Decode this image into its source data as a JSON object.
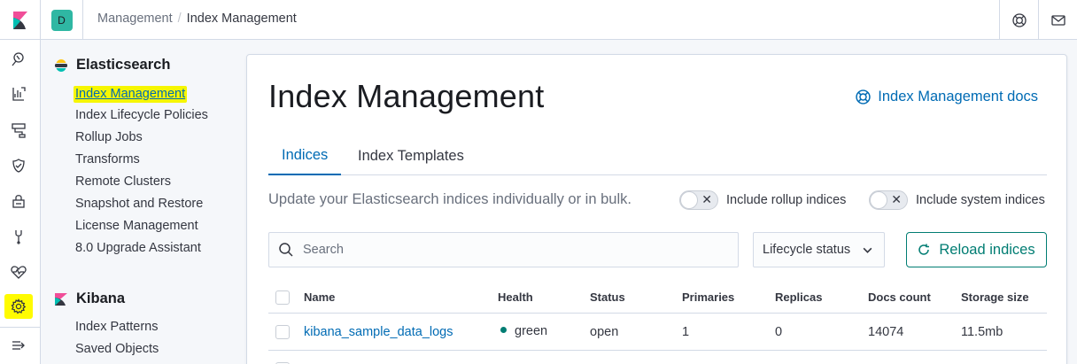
{
  "header": {
    "space_initial": "D",
    "breadcrumb_parent": "Management",
    "breadcrumb_separator": "/",
    "breadcrumb_current": "Index Management"
  },
  "left_nav_icons": [
    "discover-icon",
    "visualize-icon",
    "canvas-icon",
    "siem-icon",
    "security-icon",
    "dev-tools-icon",
    "monitoring-icon",
    "management-gear-icon",
    "collapse-menu-icon"
  ],
  "sidenav": {
    "elasticsearch_title": "Elasticsearch",
    "elasticsearch_items": [
      "Index Management",
      "Index Lifecycle Policies",
      "Rollup Jobs",
      "Transforms",
      "Remote Clusters",
      "Snapshot and Restore",
      "License Management",
      "8.0 Upgrade Assistant"
    ],
    "kibana_title": "Kibana",
    "kibana_items": [
      "Index Patterns",
      "Saved Objects"
    ]
  },
  "main": {
    "title": "Index Management",
    "docs_link": "Index Management docs",
    "tabs": [
      "Indices",
      "Index Templates"
    ],
    "description": "Update your Elasticsearch indices individually or in bulk.",
    "toggle_rollup": "Include rollup indices",
    "toggle_system": "Include system indices",
    "toggle_symbol": "✕",
    "search_placeholder": "Search",
    "lifecycle_select": "Lifecycle status",
    "reload_button": "Reload indices"
  },
  "table": {
    "columns": [
      "Name",
      "Health",
      "Status",
      "Primaries",
      "Replicas",
      "Docs count",
      "Storage size"
    ],
    "rows": [
      {
        "name": "kibana_sample_data_logs",
        "health": "green",
        "status": "open",
        "primaries": "1",
        "replicas": "0",
        "docs_count": "14074",
        "storage_size": "11.5mb"
      }
    ]
  },
  "colors": {
    "link": "#006bb4",
    "accent_teal": "#017d73",
    "highlight": "#fffb00"
  }
}
